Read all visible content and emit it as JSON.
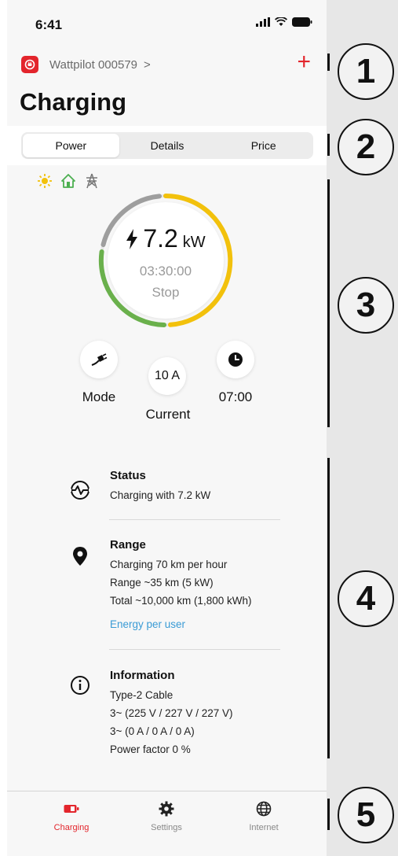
{
  "status_bar": {
    "time": "6:41"
  },
  "device": {
    "name": "Wattpilot 000579",
    "chevron": ">",
    "add": "+"
  },
  "page": {
    "title": "Charging"
  },
  "tabs": [
    {
      "label": "Power",
      "active": true
    },
    {
      "label": "Details",
      "active": false
    },
    {
      "label": "Price",
      "active": false
    }
  ],
  "energy_sources": [
    "sun-icon",
    "home-icon",
    "grid-pylon-icon"
  ],
  "gauge": {
    "power_value": "7.2",
    "power_unit": "kW",
    "timer": "03:30:00",
    "stop_label": "Stop",
    "colors": {
      "grey": "#9e9e9e",
      "green": "#6ab04c",
      "yellow": "#f2c10c"
    }
  },
  "controls": {
    "mode_label": "Mode",
    "current_value": "10 A",
    "current_label": "Current",
    "timer_value": "07:00"
  },
  "status": {
    "title": "Status",
    "text": "Charging with 7.2 kW"
  },
  "range": {
    "title": "Range",
    "lines": [
      "Charging 70 km per hour",
      "Range ~35 km (5 kW)",
      "Total ~10,000 km (1,800 kWh)"
    ],
    "link": "Energy per user"
  },
  "information": {
    "title": "Information",
    "lines": [
      "Type-2 Cable",
      "3~ (225 V / 227 V / 227 V)",
      "3~ (0 A / 0 A / 0 A)",
      "Power factor 0 %"
    ]
  },
  "nav": [
    {
      "label": "Charging",
      "icon": "battery-icon",
      "active": true
    },
    {
      "label": "Settings",
      "icon": "gear-icon",
      "active": false
    },
    {
      "label": "Internet",
      "icon": "globe-icon",
      "active": false
    }
  ],
  "callouts": [
    "1",
    "2",
    "3",
    "4",
    "5"
  ],
  "colors": {
    "accent": "#e3252c",
    "link": "#3a9bd5"
  }
}
